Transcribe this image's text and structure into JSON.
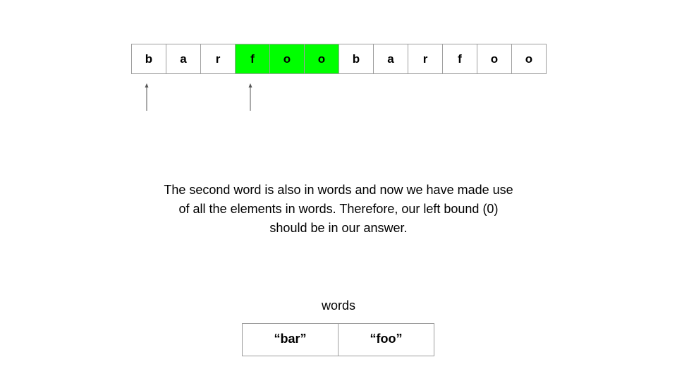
{
  "string_chars": [
    {
      "char": "b",
      "highlighted": false
    },
    {
      "char": "a",
      "highlighted": false
    },
    {
      "char": "r",
      "highlighted": false
    },
    {
      "char": "f",
      "highlighted": true
    },
    {
      "char": "o",
      "highlighted": true
    },
    {
      "char": "o",
      "highlighted": true
    },
    {
      "char": "b",
      "highlighted": false
    },
    {
      "char": "a",
      "highlighted": false
    },
    {
      "char": "r",
      "highlighted": false
    },
    {
      "char": "f",
      "highlighted": false
    },
    {
      "char": "o",
      "highlighted": false
    },
    {
      "char": "o",
      "highlighted": false
    }
  ],
  "pointers": [
    {
      "name": "left-pointer",
      "index": 0
    },
    {
      "name": "right-pointer",
      "index": 3
    }
  ],
  "caption": {
    "lines": [
      "The second word is also in words and now we have made use",
      "of all the elements in words. Therefore, our left bound (0)",
      "should be in our answer."
    ]
  },
  "words": {
    "label": "words",
    "items": [
      "“bar”",
      "“foo”"
    ]
  },
  "colors": {
    "highlight": "#00ff00",
    "border": "#9e9e9e",
    "arrow": "#555555"
  }
}
